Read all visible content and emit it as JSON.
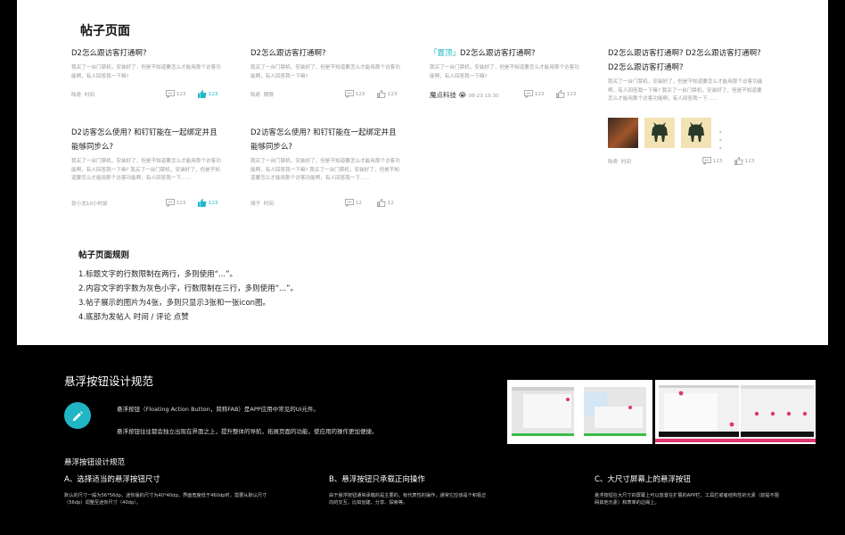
{
  "page_title": "帖子页面",
  "posts": [
    {
      "title": "D2怎么跟访客打通啊?",
      "content": "我买了一台门禁机，安装好了，但是不知道要怎么才能用那个访客功能啊，有人回答我一下嘛?",
      "author": "陆奇",
      "time": "时间",
      "comments": "123",
      "likes": "123",
      "liked": true
    },
    {
      "title": "D2怎么跟访客打通啊?",
      "content": "我买了一台门禁机，安装好了，但是不知道要怎么才能用那个访客功能啊，有人回答我一下嘛?",
      "author": "陆奇",
      "time": "期限",
      "comments": "123",
      "likes": "123",
      "liked": false
    },
    {
      "pin": "「置顶」",
      "title": "D2怎么跟访客打通啊?",
      "content": "我买了一台门禁机，安装好了，但是不知道要怎么才能用那个访客功能啊，有人回答我一下嘛?",
      "author": "魔点科技",
      "time": "08-23  15:30",
      "comments": "123",
      "likes": "123",
      "liked": false
    },
    {
      "title": "D2怎么跟访客打通啊? D2怎么跟访客打通啊? D2怎么跟访客打通啊?",
      "content": "我买了一台门禁机，安装好了，但是不知道要怎么才能用那个访客功能啊，有人回答我一下嘛? 我买了一台门禁机，安装好了，但是不知道要怎么才能用那个访客功能啊，有人回答我一下......",
      "author": "陆奇",
      "time": "时间",
      "comments": "123",
      "likes": "123",
      "liked": false
    },
    {
      "title": "D2访客怎么使用?  和钉钉能在一起绑定并且能够同步么?",
      "content": "我买了一台门禁机，安装好了，但是不知道要怎么才能用那个访客功能啊，有人回答我一下嘛? 我买了一台门禁机，安装好了，但是不知道要怎么才能用那个访客功能啊，有人回答我一下......",
      "author": "张小龙10小时前",
      "time": "",
      "comments": "123",
      "likes": "123",
      "liked": true
    },
    {
      "title": "D2访客怎么使用?  和钉钉能在一起绑定并且能够同步么?",
      "content": "我买了一台门禁机，安装好了，但是不知道要怎么才能用那个访客功能啊，有人回答我一下嘛? 我买了一台门禁机，安装好了，但是不知道要怎么才能用那个访客功能啊，有人回答我一下......",
      "author": "胡子",
      "time": "时间",
      "comments": "12",
      "likes": "12",
      "liked": false
    }
  ],
  "rules": {
    "heading": "帖子页面规则",
    "items": [
      "1.标题文字的行数限制在两行，多则使用“...”。",
      "2.内容文字的字数为灰色小字，行数限制在三行，多则使用“...”。",
      "3.帖子展示的图片为4张，多则只显示3张和一张icon图。",
      "4.底部为发帖人 时间 /  评论   点赞"
    ]
  },
  "fab_section": {
    "title": "悬浮按钮设计规范",
    "icon": "pencil-icon",
    "desc1": "悬浮按钮（Floating Action Button，简称FAB）是APP应用中常见的UI元件。",
    "desc2": "悬浮按钮往往都会独立出现在界面之上，提升整体的导航，拓展页面的功能，使应用的操作更加便捷。",
    "subheading": "悬浮按钮设计规范",
    "cols": [
      {
        "h": "A、选择适当的悬浮按钮尺寸",
        "d": "默认的尺寸一般为56*56dp，迷你版的尺寸为40*40dp。界面宽度低于460dp时，需要从默认尺寸（56dp）调整至迷你尺寸（40dp）。"
      },
      {
        "h": "B、悬浮按钮只承载正向操作",
        "d": "由于悬浮按钮通常承载的是主要的、有代表性的操作，通常它应该是个积极正向的交互，比如创建、分享、探索等。"
      },
      {
        "h": "C、大尺寸屏幕上的悬浮按钮",
        "d": "悬浮按钮在大尺寸的屏幕上可以放置在扩展的APP栏、工具栏或者结构性的元素（前提不阻碍其他元素）和表单的边缘上。"
      }
    ]
  },
  "colors": {
    "accent": "#1fb8c8",
    "fab": "#20b6c6",
    "pink": "#e0366b"
  }
}
